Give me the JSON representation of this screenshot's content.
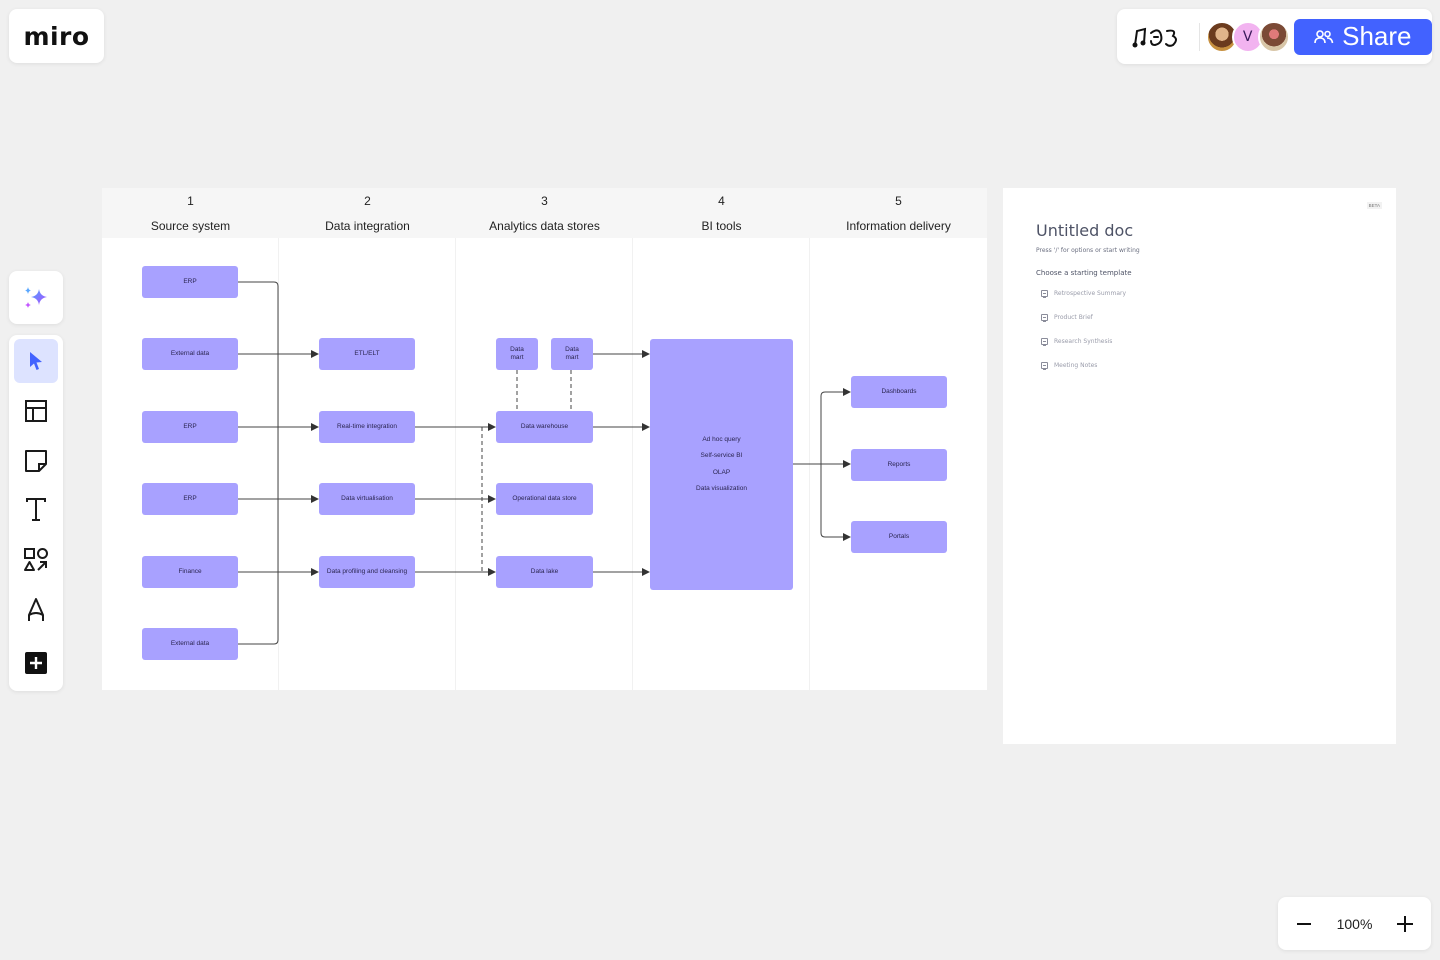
{
  "app": {
    "logo": "miro"
  },
  "topbar": {
    "reactions_label": "♫☺3",
    "avatars": [
      {
        "name": "collaborator-1",
        "initial": "",
        "color": "#b57a43"
      },
      {
        "name": "collaborator-v",
        "initial": "V",
        "color": "#f2b3f0"
      },
      {
        "name": "collaborator-2",
        "initial": "",
        "color": "#c9a98a"
      }
    ],
    "share_label": "Share",
    "share_color": "#4262ff"
  },
  "toolbar": {
    "ai_label": "AI",
    "tools": [
      {
        "name": "select",
        "label": "Select",
        "active": true
      },
      {
        "name": "templates",
        "label": "Templates"
      },
      {
        "name": "sticky-note",
        "label": "Sticky note"
      },
      {
        "name": "text",
        "label": "Text"
      },
      {
        "name": "shapes",
        "label": "Shapes and lines"
      },
      {
        "name": "pen",
        "label": "Pen"
      },
      {
        "name": "more",
        "label": "More apps"
      }
    ]
  },
  "zoom": {
    "value": "100%",
    "minus": "−",
    "plus": "+"
  },
  "diagram": {
    "node_color": "#a8a1ff",
    "columns": [
      {
        "num": "1",
        "title": "Source system"
      },
      {
        "num": "2",
        "title": "Data integration"
      },
      {
        "num": "3",
        "title": "Analytics data stores"
      },
      {
        "num": "4",
        "title": "BI tools"
      },
      {
        "num": "5",
        "title": "Information delivery"
      }
    ],
    "sources": [
      "ERP",
      "External data",
      "ERP",
      "ERP",
      "Finance",
      "External data"
    ],
    "integration": [
      "ETL/ELT",
      "Real-time integration",
      "Data virtualisation",
      "Data profiling and cleansing"
    ],
    "stores": {
      "marts": [
        "Data mart",
        "Data mart"
      ],
      "warehouse": "Data warehouse",
      "ods": "Operational data store",
      "lake": "Data lake"
    },
    "bi_tools": [
      "Ad hoc query",
      "Self-service BI",
      "OLAP",
      "Data visualization"
    ],
    "delivery": [
      "Dashboards",
      "Reports",
      "Portals"
    ]
  },
  "doc": {
    "badge": "BETA",
    "title": "Untitled doc",
    "hint": "Press '/' for options or start writing",
    "choose_label": "Choose a starting template",
    "templates": [
      "Retrospective Summary",
      "Product Brief",
      "Research Synthesis",
      "Meeting Notes"
    ]
  }
}
